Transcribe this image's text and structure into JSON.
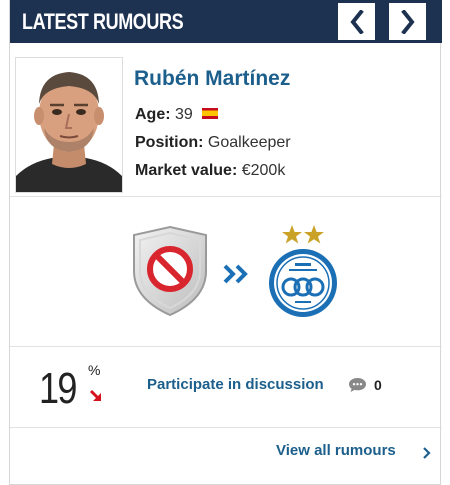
{
  "header": {
    "title": "LATEST RUMOURS",
    "prev_icon": "chevron-left-icon",
    "next_icon": "chevron-right-icon"
  },
  "player": {
    "name": "Rubén Martínez",
    "age_label": "Age:",
    "age_value": "39",
    "nationality_flag": "spain-flag-icon",
    "position_label": "Position:",
    "position_value": "Goalkeeper",
    "market_value_label": "Market value:",
    "market_value_value": "€200k"
  },
  "transfer": {
    "from_club_icon": "no-club-crest-icon",
    "arrow_icon": "double-chevron-right-icon",
    "to_club_icon": "club-crest-icon"
  },
  "rumour_stats": {
    "probability": "19",
    "probability_unit": "%",
    "trend_icon": "trend-down-arrow-icon",
    "discussion_label": "Participate in discussion",
    "discussion_count": "0"
  },
  "footer": {
    "view_all_label": "View all rumours"
  },
  "colors": {
    "header_bg": "#1d3150",
    "link": "#1d5f8c",
    "trend_down": "#d6121f",
    "club_blue": "#1a6fb5",
    "club_star": "#c9a227"
  }
}
